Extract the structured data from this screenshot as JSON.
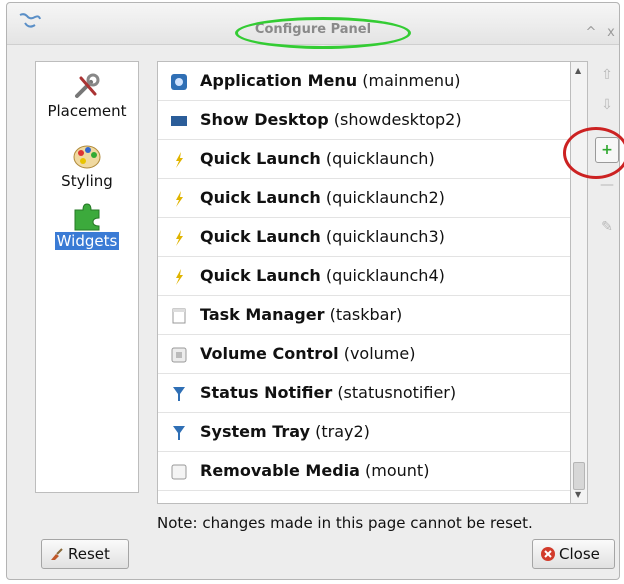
{
  "window": {
    "title": "Configure Panel",
    "controls": {
      "maximize": "^",
      "close": "x"
    }
  },
  "sidebar": {
    "items": [
      {
        "label": "Placement",
        "icon": "wrench-screwdriver-icon",
        "selected": false
      },
      {
        "label": "Styling",
        "icon": "paint-palette-icon",
        "selected": false
      },
      {
        "label": "Widgets",
        "icon": "puzzle-piece-icon",
        "selected": true
      }
    ]
  },
  "widgets": [
    {
      "name": "Application Menu",
      "id": "(mainmenu)",
      "icon": "app-menu-icon"
    },
    {
      "name": "Show Desktop",
      "id": "(showdesktop2)",
      "icon": "desktop-icon"
    },
    {
      "name": "Quick Launch",
      "id": "(quicklaunch)",
      "icon": "launcher-icon"
    },
    {
      "name": "Quick Launch",
      "id": "(quicklaunch2)",
      "icon": "launcher-icon"
    },
    {
      "name": "Quick Launch",
      "id": "(quicklaunch3)",
      "icon": "launcher-icon"
    },
    {
      "name": "Quick Launch",
      "id": "(quicklaunch4)",
      "icon": "launcher-icon"
    },
    {
      "name": "Task Manager",
      "id": "(taskbar)",
      "icon": "taskbar-icon"
    },
    {
      "name": "Volume Control",
      "id": "(volume)",
      "icon": "volume-icon"
    },
    {
      "name": "Status Notifier",
      "id": "(statusnotifier)",
      "icon": "notifier-icon"
    },
    {
      "name": "System Tray",
      "id": "(tray2)",
      "icon": "tray-icon"
    },
    {
      "name": "Removable Media",
      "id": "(mount)",
      "icon": "media-icon"
    }
  ],
  "side_buttons": {
    "move_up": "⇧",
    "move_down": "⇩",
    "add": "+",
    "remove": "—",
    "configure": "✎"
  },
  "note": "Note: changes made in this page cannot be reset.",
  "buttons": {
    "reset": "Reset",
    "close": "Close"
  },
  "colors": {
    "selection": "#3a7bd5",
    "title_annotation": "#33cc33",
    "add_annotation": "#cc2222",
    "add_icon": "#2ea82e"
  }
}
